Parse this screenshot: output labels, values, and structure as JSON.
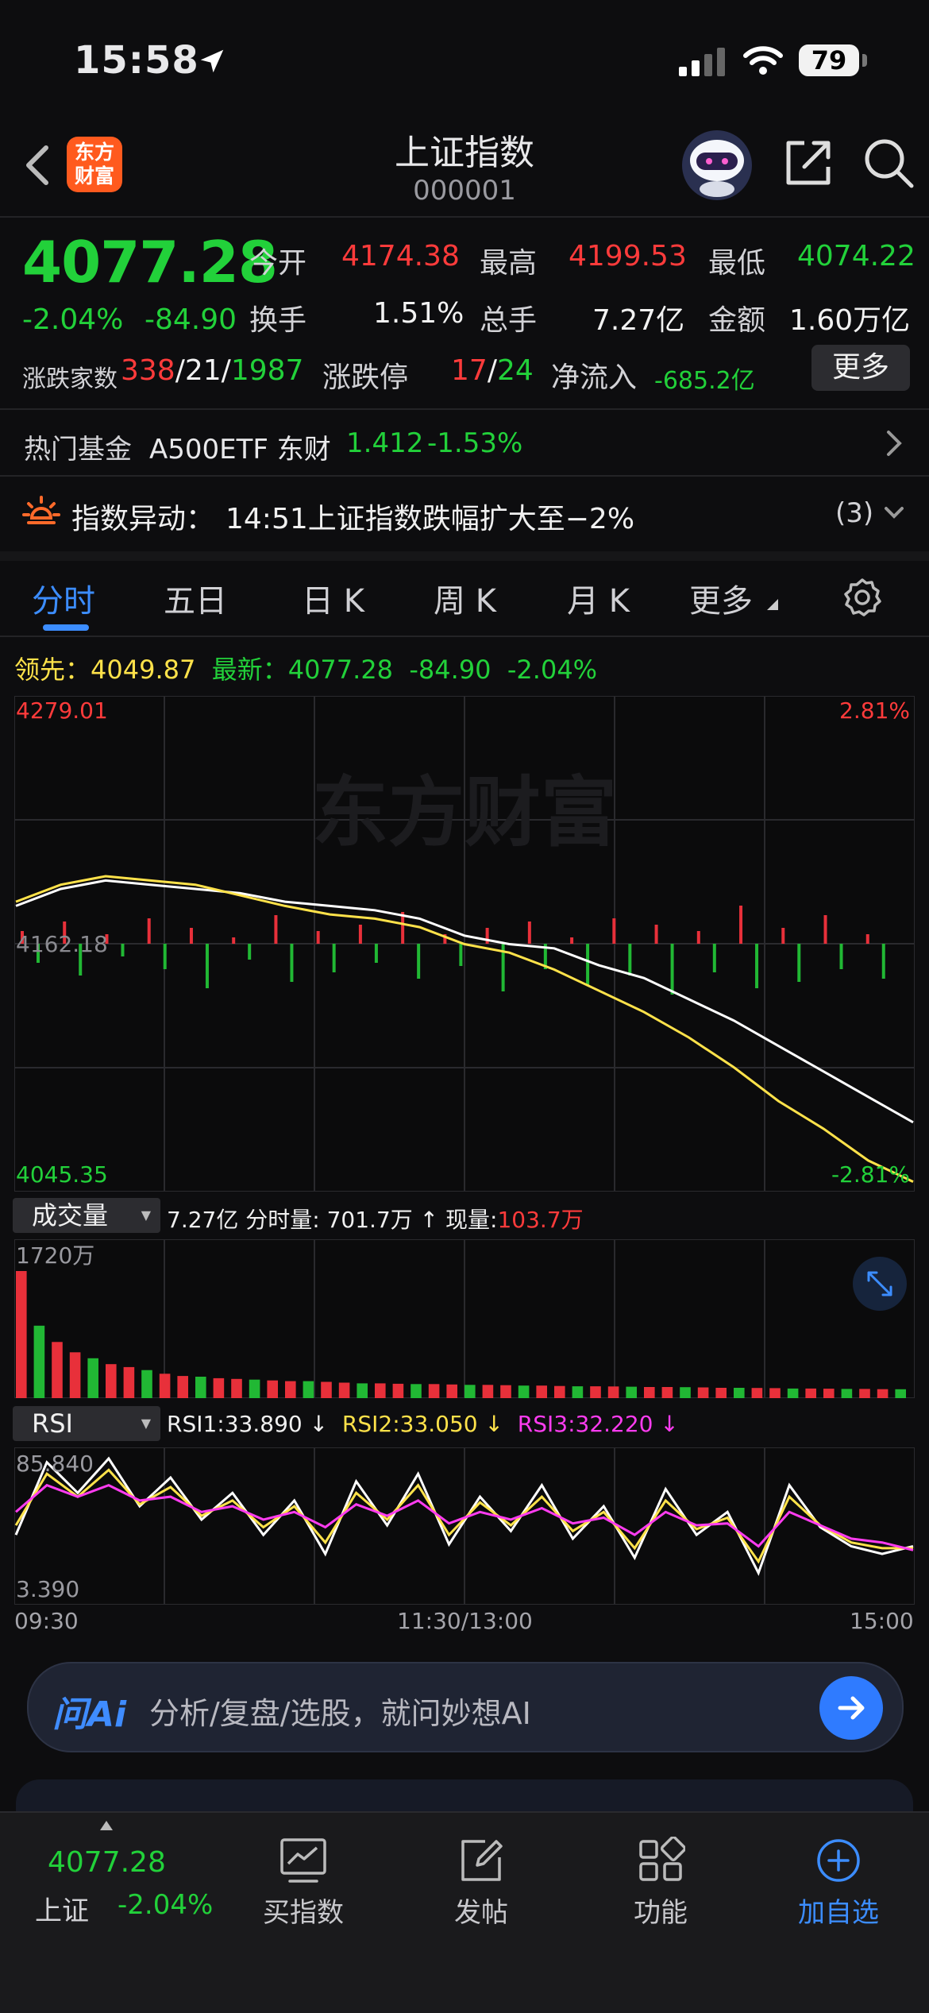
{
  "status_bar": {
    "time": "15:58",
    "battery": "79"
  },
  "header": {
    "logo_line1": "东方",
    "logo_line2": "财富",
    "title": "上证指数",
    "code": "000001"
  },
  "quote": {
    "price": "4077.28",
    "change_pct": "-2.04%",
    "change": "-84.90",
    "open_label": "今开",
    "open": "4174.38",
    "high_label": "最高",
    "high": "4199.53",
    "low_label": "最低",
    "low": "4074.22",
    "turnover_label": "换手",
    "turnover": "1.51%",
    "volume_label": "总手",
    "volume": "7.27亿",
    "amount_label": "金额",
    "amount": "1.60万亿",
    "breadth_label": "涨跌家数",
    "up": "338",
    "flat": "21",
    "down": "1987",
    "limit_label": "涨跌停",
    "limit_up": "17",
    "limit_down": "24",
    "netflow_label": "净流入",
    "netflow": "-685.2亿",
    "more_label": "更多"
  },
  "hot_fund": {
    "label": "热门基金",
    "name": "A500ETF 东财",
    "price": "1.412",
    "change": "-1.53%"
  },
  "alert": {
    "label": "指数异动：",
    "text": "14:51上证指数跌幅扩大至−2%",
    "count": "(3)"
  },
  "tabs": [
    {
      "label": "分时",
      "active": true
    },
    {
      "label": "五日"
    },
    {
      "label": "日 K"
    },
    {
      "label": "周 K"
    },
    {
      "label": "月 K"
    },
    {
      "label": "更多"
    }
  ],
  "info_line": {
    "lead_label": "领先：",
    "lead_value": "4049.87",
    "latest_label": "最新：",
    "latest_value": "4077.28",
    "latest_change": "-84.90",
    "latest_pct": "-2.04%"
  },
  "chart_data": [
    {
      "type": "line",
      "title": "",
      "ylim": [
        4045.35,
        4279.01
      ],
      "y_top_label": "4279.01",
      "y_mid_label": "4162.18",
      "y_bottom_label": "4045.35",
      "pct_top_label": "2.81%",
      "pct_bottom_label": "-2.81%",
      "watermark": "东方财富",
      "x": [
        0,
        12,
        24,
        36,
        48,
        60,
        72,
        84,
        96,
        108,
        120,
        132,
        144,
        156,
        168,
        180,
        192,
        204,
        216,
        228,
        240
      ],
      "series": [
        {
          "values": [
            4180,
            4188,
            4192,
            4190,
            4188,
            4186,
            4182,
            4180,
            4178,
            4174,
            4166,
            4162,
            4160,
            4152,
            4146,
            4136,
            4126,
            4114,
            4102,
            4090,
            4078
          ]
        },
        {
          "values": [
            4182,
            4190,
            4194,
            4192,
            4190,
            4185,
            4180,
            4176,
            4174,
            4170,
            4162,
            4158,
            4150,
            4140,
            4130,
            4118,
            4104,
            4088,
            4075,
            4060,
            4050
          ]
        }
      ],
      "bars_pos": [
        4,
        7,
        3,
        8,
        5,
        2,
        9,
        4,
        6,
        10,
        3,
        5,
        7,
        2,
        8,
        6,
        4,
        12,
        5,
        9,
        3
      ],
      "bars_neg": [
        -6,
        -10,
        -4,
        -8,
        -14,
        -5,
        -12,
        -9,
        -6,
        -11,
        -7,
        -15,
        -8,
        -13,
        -10,
        -16,
        -9,
        -14,
        -12,
        -8,
        -11
      ]
    },
    {
      "type": "bar",
      "title": "",
      "label": "成交量",
      "summary_total": "7.27亿",
      "summary_interval_label": "分时量:",
      "summary_interval": "701.7万 ↑",
      "summary_current_label": "现量:",
      "summary_current": "103.7万",
      "y_max_label": "1720万",
      "ylim": [
        0,
        1720
      ],
      "values": [
        1720,
        980,
        760,
        620,
        540,
        460,
        420,
        380,
        330,
        300,
        290,
        270,
        260,
        250,
        240,
        230,
        230,
        220,
        210,
        200,
        200,
        195,
        190,
        190,
        185,
        180,
        180,
        175,
        170,
        170,
        165,
        160,
        160,
        158,
        155,
        150,
        150,
        148,
        145,
        140,
        140,
        138,
        135,
        130,
        130,
        128,
        125,
        125,
        122,
        120
      ]
    },
    {
      "type": "line",
      "title": "",
      "label": "RSI",
      "ylim": [
        3.39,
        85.84
      ],
      "y_top_label": "85.840",
      "y_bottom_label": "3.390",
      "legend": [
        {
          "name": "RSI1:33.890 ↓",
          "color": "#ffffff"
        },
        {
          "name": "RSI2:33.050 ↓",
          "color": "#ffe24a"
        },
        {
          "name": "RSI3:32.220 ↓",
          "color": "#ff3cf0"
        }
      ],
      "series": [
        {
          "color": "#ffffff",
          "values": [
            40,
            78,
            62,
            80,
            55,
            70,
            48,
            62,
            40,
            58,
            30,
            68,
            45,
            72,
            35,
            60,
            42,
            66,
            38,
            55,
            28,
            64,
            40,
            52,
            20,
            66,
            44,
            34,
            30,
            34
          ]
        },
        {
          "color": "#ffe24a",
          "values": [
            45,
            72,
            60,
            74,
            56,
            65,
            50,
            58,
            44,
            55,
            36,
            62,
            48,
            66,
            40,
            57,
            45,
            60,
            42,
            52,
            33,
            58,
            43,
            49,
            26,
            60,
            45,
            36,
            33,
            33
          ]
        },
        {
          "color": "#ff3cf0",
          "values": [
            52,
            66,
            60,
            66,
            58,
            60,
            52,
            55,
            48,
            52,
            44,
            56,
            50,
            58,
            46,
            52,
            48,
            54,
            46,
            49,
            40,
            52,
            45,
            46,
            34,
            52,
            45,
            38,
            36,
            32
          ]
        }
      ]
    }
  ],
  "time_axis": {
    "start": "09:30",
    "mid": "11:30/13:00",
    "end": "15:00"
  },
  "ai_bar": {
    "logo": "问Ai",
    "placeholder": "分析/复盘/选股，就问妙想AI"
  },
  "bottom_nav": {
    "index_price": "4077.28",
    "index_name": "上证",
    "index_pct": "-2.04%",
    "items": [
      {
        "label": "买指数"
      },
      {
        "label": "发帖"
      },
      {
        "label": "功能"
      },
      {
        "label": "加自选"
      }
    ]
  }
}
